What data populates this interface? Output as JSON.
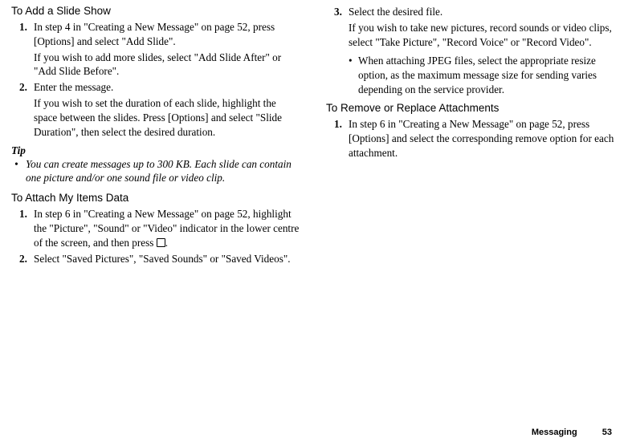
{
  "left": {
    "h1": "To Add a Slide Show",
    "li1": "In step 4 in \"Creating a New Message\" on page 52, press [Options] and select \"Add Slide\".",
    "li1b": "If you wish to add more slides, select \"Add Slide After\" or \"Add Slide Before\".",
    "li2": "Enter the message.",
    "li2b": "If you wish to set the duration of each slide, highlight the space between the slides. Press [Options] and select \"Slide Duration\", then select the desired duration.",
    "tipLabel": "Tip",
    "tipBody": "You can create messages up to 300 KB. Each slide can contain one picture and/or one sound file or video clip.",
    "h2": "To Attach My Items Data",
    "a_li1_pre": "In step 6 in \"Creating a New Message\" on page 52, highlight the \"Picture\", \"Sound\" or \"Video\" indicator in the lower centre of the screen, and then press ",
    "a_li1_post": ".",
    "a_li2": "Select \"Saved Pictures\", \"Saved Sounds\" or \"Saved Videos\"."
  },
  "right": {
    "li3": "Select the desired file.",
    "li3b": "If you wish to take new pictures, record sounds or video clips, select \"Take Picture\", \"Record Voice\" or \"Record Video\".",
    "bullet": "When attaching JPEG files, select the appropriate resize option, as the maximum message size for sending varies depending on the service provider.",
    "h3": "To Remove or Replace Attachments",
    "r_li1": "In step 6 in \"Creating a New Message\" on page 52, press [Options] and select the corresponding remove option for each attachment."
  },
  "footer": {
    "section": "Messaging",
    "page": "53"
  }
}
